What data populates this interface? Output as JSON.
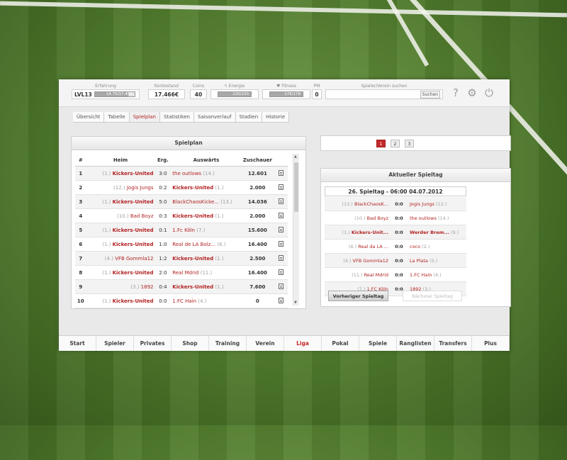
{
  "header": {
    "erfahrung": {
      "label": "Erfahrung",
      "level": "LVL13",
      "bar_text": "14.75/17.455",
      "progress": 0.85
    },
    "kontostand": {
      "label": "Kontostand",
      "value": "17.466€"
    },
    "coins": {
      "label": "Coins",
      "value": "40"
    },
    "energie": {
      "label": "Energie",
      "bar_text": "220/220",
      "progress": 1.0
    },
    "fitness": {
      "label": "Fitness",
      "bar_text": "178/178",
      "progress": 1.0
    },
    "pm": {
      "label": "PM",
      "value": "0"
    },
    "search": {
      "label": "Spieler/Verein suchen",
      "placeholder": "",
      "button": "Suchen"
    },
    "icons": {
      "help": "help-icon",
      "settings": "gear-icon",
      "logout": "power-icon"
    }
  },
  "tabs": [
    "Übersicht",
    "Tabelle",
    "Spielplan",
    "Statistiken",
    "Saisonverlauf",
    "Stadien",
    "Historie"
  ],
  "active_tab": "Spielplan",
  "spielplan": {
    "title": "Spielplan",
    "columns": [
      "#",
      "Heim",
      "Erg.",
      "Auswärts",
      "Zuschauer"
    ],
    "rows": [
      {
        "nr": "1",
        "home_rank": "(1.)",
        "home": "Kickers-United",
        "result": "3:0",
        "away": "the outlows",
        "away_rank": "(14.)",
        "zuschauer": "12.601",
        "home_own": true,
        "away_own": false
      },
      {
        "nr": "2",
        "home_rank": "(12.)",
        "home": "Jogis Jungs",
        "result": "0:2",
        "away": "Kickers-United",
        "away_rank": "(1.)",
        "zuschauer": "2.000",
        "home_own": false,
        "away_own": true
      },
      {
        "nr": "3",
        "home_rank": "(1.)",
        "home": "Kickers-United",
        "result": "5:0",
        "away": "BlackChaosKicke...",
        "away_rank": "(13.)",
        "zuschauer": "14.036",
        "home_own": true,
        "away_own": false
      },
      {
        "nr": "4",
        "home_rank": "(10.)",
        "home": "Bad Boyz",
        "result": "0:3",
        "away": "Kickers-United",
        "away_rank": "(1.)",
        "zuschauer": "2.000",
        "home_own": false,
        "away_own": true
      },
      {
        "nr": "5",
        "home_rank": "(1.)",
        "home": "Kickers-United",
        "result": "0:1",
        "away": "1.Fc Köln",
        "away_rank": "(7.)",
        "zuschauer": "15.600",
        "home_own": true,
        "away_own": false
      },
      {
        "nr": "6",
        "home_rank": "(1.)",
        "home": "Kickers-United",
        "result": "1:0",
        "away": "Real de LA Bolz...",
        "away_rank": "(6.)",
        "zuschauer": "16.400",
        "home_own": true,
        "away_own": false
      },
      {
        "nr": "7",
        "home_rank": "(4.)",
        "home": "VFB Gommla12",
        "result": "1:2",
        "away": "Kickers-United",
        "away_rank": "(1.)",
        "zuschauer": "2.500",
        "home_own": false,
        "away_own": true
      },
      {
        "nr": "8",
        "home_rank": "(1.)",
        "home": "Kickers-United",
        "result": "2:0",
        "away": "Real Mdrid",
        "away_rank": "(11.)",
        "zuschauer": "16.400",
        "home_own": true,
        "away_own": false
      },
      {
        "nr": "9",
        "home_rank": "(3.)",
        "home": "1892",
        "result": "0:4",
        "away": "Kickers-United",
        "away_rank": "(1.)",
        "zuschauer": "7.600",
        "home_own": false,
        "away_own": true
      },
      {
        "nr": "10",
        "home_rank": "(1.)",
        "home": "Kickers-United",
        "result": "0:0",
        "away": "1.FC Hain",
        "away_rank": "(4.)",
        "zuschauer": "0",
        "home_own": true,
        "away_own": false
      }
    ]
  },
  "pagination": {
    "pages": [
      "1",
      "2",
      "3"
    ],
    "active": "1"
  },
  "aktueller_spieltag": {
    "title": "Aktueller Spieltag",
    "heading": "26. Spieltag - 06:00 04.07.2012",
    "matches": [
      {
        "home_rank": "(13.)",
        "home": "BlackChaosK...",
        "score": "0:0",
        "away": "Jogis Jungs",
        "away_rank": "(12.)",
        "highlight": false
      },
      {
        "home_rank": "(10.)",
        "home": "Bad Boyz",
        "score": "0:0",
        "away": "the outlows",
        "away_rank": "(14.)",
        "highlight": false
      },
      {
        "home_rank": "(1.)",
        "home": "Kickers-Unit...",
        "score": "0:0",
        "away": "Werder Brem...",
        "away_rank": "(9.)",
        "highlight": true
      },
      {
        "home_rank": "(6.)",
        "home": "Real da LA ...",
        "score": "0:0",
        "away": "coco",
        "away_rank": "(2.)",
        "highlight": false
      },
      {
        "home_rank": "(4.)",
        "home": "VFB Gommla12",
        "score": "0:0",
        "away": "La Plata",
        "away_rank": "(5.)",
        "highlight": false
      },
      {
        "home_rank": "(11.)",
        "home": "Real Mdrid",
        "score": "0:0",
        "away": "1.FC Hain",
        "away_rank": "(4.)",
        "highlight": false
      },
      {
        "home_rank": "(7.)",
        "home": "1.FC Köln",
        "score": "0:0",
        "away": "1892",
        "away_rank": "(3.)",
        "highlight": false
      }
    ],
    "prev_button": "Vorheriger Spieltag",
    "next_button": "Nächster Spieltag"
  },
  "nav": [
    "Start",
    "Spieler",
    "Privates",
    "Shop",
    "Training",
    "Verein",
    "Liga",
    "Pokal",
    "Spiele",
    "Ranglisten",
    "Transfers",
    "Plus"
  ],
  "active_nav": "Liga",
  "colors": {
    "accent": "#c62828",
    "text": "#333333",
    "muted": "#a0a0a0"
  }
}
